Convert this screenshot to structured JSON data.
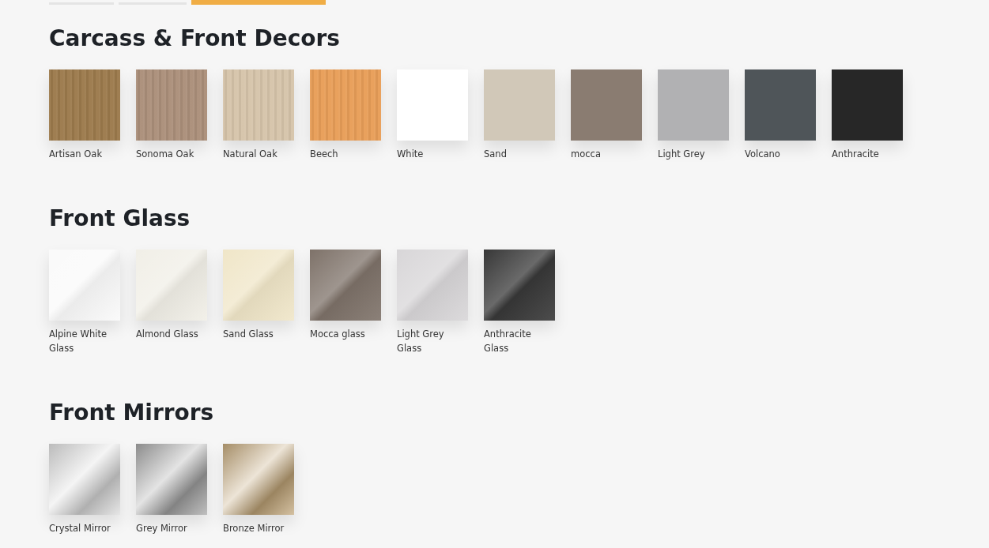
{
  "tabs": [
    {
      "selected": false
    },
    {
      "selected": false
    },
    {
      "selected": true
    }
  ],
  "sections": [
    {
      "title": "Carcass & Front Decors",
      "swatches": [
        {
          "name": "Artisan Oak",
          "kind": "wood",
          "color": "#9c7a4c"
        },
        {
          "name": "Sonoma Oak",
          "kind": "wood",
          "color": "#ab8f7a"
        },
        {
          "name": "Natural Oak",
          "kind": "wood",
          "color": "#d6c4aa"
        },
        {
          "name": "Beech",
          "kind": "wood",
          "color": "#e89e58"
        },
        {
          "name": "White",
          "kind": "plain",
          "color": "#ffffff"
        },
        {
          "name": "Sand",
          "kind": "plain",
          "color": "#d1c8b8"
        },
        {
          "name": "mocca",
          "kind": "plain",
          "color": "#8a7c71"
        },
        {
          "name": "Light Grey",
          "kind": "plain",
          "color": "#b1b1b3"
        },
        {
          "name": "Volcano",
          "kind": "plain",
          "color": "#4f5559"
        },
        {
          "name": "Anthracite",
          "kind": "plain",
          "color": "#272727"
        }
      ]
    },
    {
      "title": "Front Glass",
      "swatches": [
        {
          "name": "Alpine White Glass",
          "kind": "glass",
          "color": "#fafafa"
        },
        {
          "name": "Almond Glass",
          "kind": "glass",
          "color": "#f1efe7"
        },
        {
          "name": "Sand Glass",
          "kind": "glass",
          "color": "#f0e6c8"
        },
        {
          "name": "Mocca glass",
          "kind": "glass",
          "color": "#7e7269"
        },
        {
          "name": "Light Grey Glass",
          "kind": "glass",
          "color": "#d8d6d8"
        },
        {
          "name": "Anthracite Glass",
          "kind": "glass",
          "color": "#383838"
        }
      ]
    },
    {
      "title": "Front Mirrors",
      "swatches": [
        {
          "name": "Crystal Mirror",
          "kind": "mirror",
          "color": "#dcdcdc"
        },
        {
          "name": "Grey Mirror",
          "kind": "mirror",
          "color": "#a4a4a4"
        },
        {
          "name": "Bronze Mirror",
          "kind": "mirror",
          "color": "#c2a679"
        }
      ]
    }
  ]
}
